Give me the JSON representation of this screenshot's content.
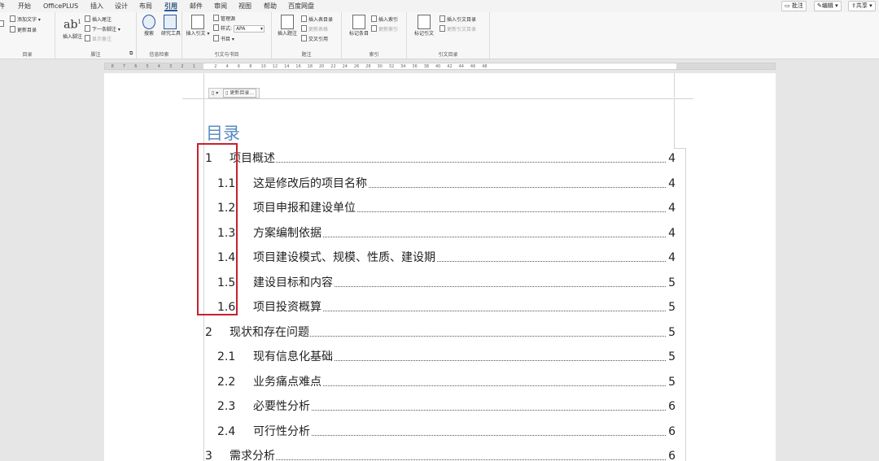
{
  "menu": {
    "tabs": [
      "件",
      "开始",
      "OfficePLUS",
      "插入",
      "设计",
      "布局",
      "引用",
      "邮件",
      "审阅",
      "视图",
      "帮助",
      "百度网盘"
    ],
    "active_tab": "引用",
    "right": {
      "comment": "批注",
      "edit": "编辑",
      "share": "共享"
    }
  },
  "ribbon": {
    "toc": {
      "add_text": "添加文字",
      "update": "更新目录",
      "group_label": "目录"
    },
    "footnote": {
      "insert": "插入脚注",
      "insert_endnote": "插入尾注",
      "next": "下一条脚注",
      "show": "显示备注",
      "group_label": "脚注"
    },
    "research": {
      "search": "搜索",
      "tools": "研究工具",
      "group_label": "信息检索"
    },
    "citation": {
      "insert": "插入引文",
      "manage": "管理源",
      "style_label": "样式:",
      "style_value": "APA",
      "biblio": "书目",
      "group_label": "引文与书目"
    },
    "caption": {
      "insert": "插入题注",
      "insert_table": "插入表目录",
      "update_table": "更新表格",
      "cross_ref": "交叉引用",
      "group_label": "题注"
    },
    "index": {
      "mark": "标记条目",
      "insert": "插入索引",
      "update": "更新索引",
      "group_label": "索引"
    },
    "authorities": {
      "mark": "标记引文",
      "insert": "插入引文目录",
      "update": "更新引文目录",
      "group_label": "引文目录"
    }
  },
  "ruler": {
    "left_ticks": [
      "8",
      "7",
      "6",
      "5",
      "4",
      "3",
      "2",
      "1"
    ],
    "right_ticks": [
      "2",
      "4",
      "6",
      "8",
      "10",
      "12",
      "14",
      "16",
      "18",
      "20",
      "22",
      "24",
      "26",
      "28",
      "30",
      "32",
      "34",
      "36",
      "38",
      "40",
      "42",
      "44",
      "46",
      "48"
    ]
  },
  "document": {
    "toc_toolbar": {
      "update_label": "更新目录..."
    },
    "toc_title": "目录",
    "entries": [
      {
        "num": "1",
        "text": "项目概述",
        "page": "4",
        "level": 1
      },
      {
        "num": "1.1",
        "text": "这是修改后的项目名称",
        "page": "4",
        "level": 2
      },
      {
        "num": "1.2",
        "text": "项目申报和建设单位",
        "page": "4",
        "level": 2
      },
      {
        "num": "1.3",
        "text": "方案编制依据",
        "page": "4",
        "level": 2
      },
      {
        "num": "1.4",
        "text": "项目建设模式、规模、性质、建设期",
        "page": "4",
        "level": 2
      },
      {
        "num": "1.5",
        "text": "建设目标和内容",
        "page": "5",
        "level": 2
      },
      {
        "num": "1.6",
        "text": "项目投资概算",
        "page": "5",
        "level": 2
      },
      {
        "num": "2",
        "text": "现状和存在问题",
        "page": "5",
        "level": 1
      },
      {
        "num": "2.1",
        "text": "现有信息化基础",
        "page": "5",
        "level": 2
      },
      {
        "num": "2.2",
        "text": "业务痛点难点",
        "page": "5",
        "level": 2
      },
      {
        "num": "2.3",
        "text": "必要性分析",
        "page": "6",
        "level": 2
      },
      {
        "num": "2.4",
        "text": "可行性分析",
        "page": "6",
        "level": 2
      },
      {
        "num": "3",
        "text": "需求分析",
        "page": "6",
        "level": 1
      }
    ]
  },
  "colors": {
    "toc_title": "#5b8bc2",
    "highlight_box": "#c8202d",
    "active_tab": "#2b579a"
  }
}
